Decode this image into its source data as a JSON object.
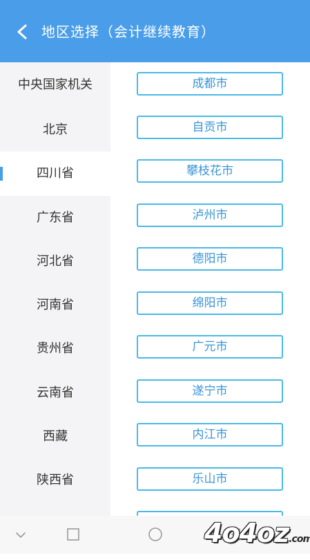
{
  "header": {
    "title": "地区选择（会计继续教育）",
    "back_icon": "back-chevron-icon"
  },
  "provinces": [
    {
      "label": "中央国家机关",
      "active": false
    },
    {
      "label": "北京",
      "active": false
    },
    {
      "label": "四川省",
      "active": true
    },
    {
      "label": "广东省",
      "active": false
    },
    {
      "label": "河北省",
      "active": false
    },
    {
      "label": "河南省",
      "active": false
    },
    {
      "label": "贵州省",
      "active": false
    },
    {
      "label": "云南省",
      "active": false
    },
    {
      "label": "西藏",
      "active": false
    },
    {
      "label": "陕西省",
      "active": false
    }
  ],
  "cities": [
    "成都市",
    "自贡市",
    "攀枝花市",
    "泸州市",
    "德阳市",
    "绵阳市",
    "广元市",
    "遂宁市",
    "内江市",
    "乐山市"
  ],
  "colors": {
    "accent": "#4a9de8",
    "city_border": "#4ab8e6",
    "city_text": "#3a95d6",
    "sidebar_bg": "#f4f4f6"
  },
  "nav_bar": {
    "icons": [
      "chevron-down-icon",
      "square-icon",
      "circle-icon",
      "triangle-icon"
    ]
  },
  "watermark": {
    "text": "4o4oz",
    "suffix": ".com"
  }
}
